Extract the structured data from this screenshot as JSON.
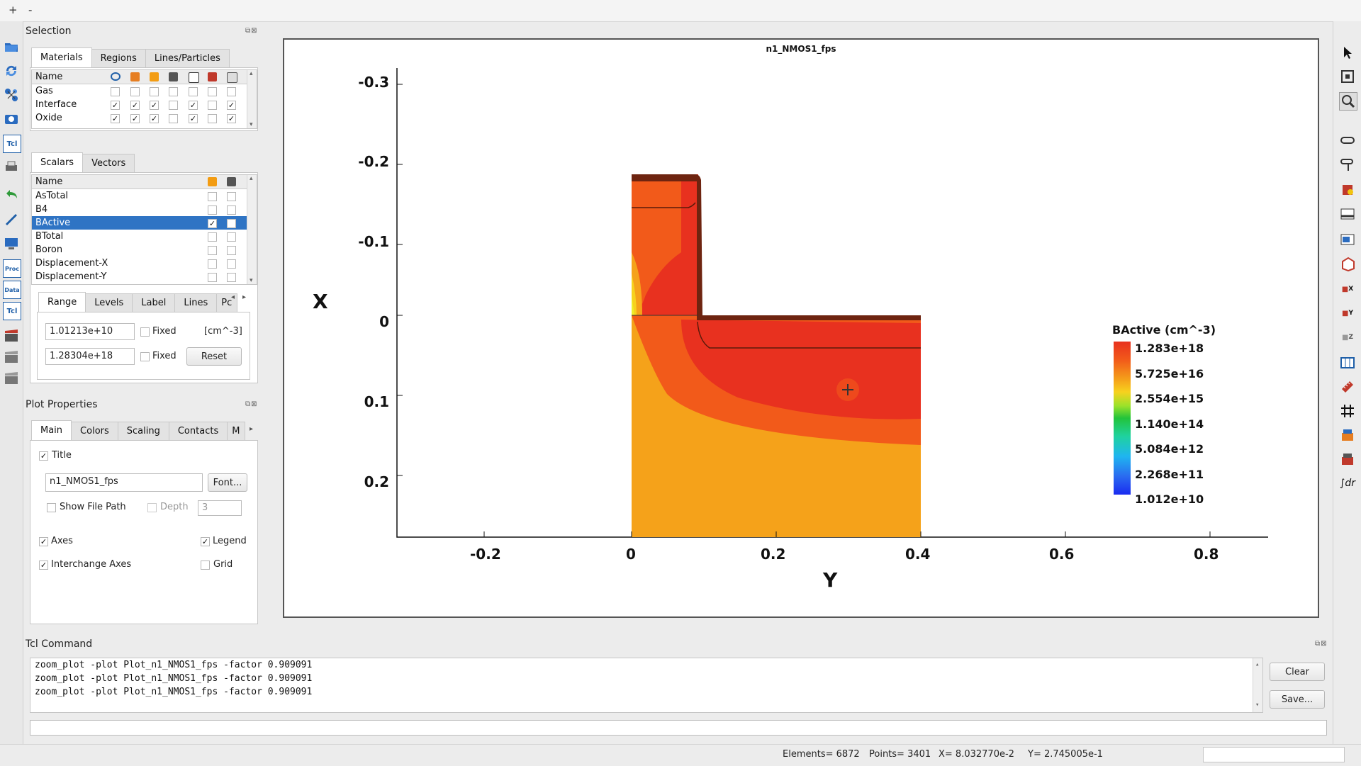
{
  "menubar": {
    "items": [
      "+",
      "-"
    ]
  },
  "left_toolbar": {
    "icons": [
      "open-folder-icon",
      "reload-icon",
      "molecule-icon",
      "camera-icon",
      "tcl-script-icon",
      "print-icon",
      "undo-icon",
      "pen-icon",
      "monitor-icon",
      "proc-icon",
      "data-icon",
      "tcl-icon",
      "clapper-icon",
      "clapper-2-icon",
      "clapper-3-icon"
    ],
    "labels": {
      "proc": "Proc",
      "data": "Data",
      "tcl": "Tcl",
      "tcl2": "Tcl"
    }
  },
  "right_toolbar": {
    "icons": [
      "pointer-icon",
      "fit-icon",
      "zoom-icon",
      "link-icon",
      "probe-icon",
      "probe-2-icon",
      "cutline-icon",
      "cutplane-icon",
      "cut-icon",
      "cut-x-icon",
      "cut-y-icon",
      "cut-z-icon",
      "data-table-icon",
      "ruler-icon",
      "grid-icon",
      "layers-icon",
      "layers-2-icon",
      "integrate-icon"
    ],
    "labels": {
      "x": "X",
      "y": "Y",
      "z": "Z",
      "integrate": "∫dr"
    }
  },
  "selection": {
    "title": "Selection",
    "tabs": [
      "Materials",
      "Regions",
      "Lines/Particles"
    ],
    "materials": {
      "header": "Name",
      "rows": [
        {
          "name": "Gas",
          "checks": [
            false,
            false,
            false,
            false,
            false,
            false,
            false
          ]
        },
        {
          "name": "Interface",
          "checks": [
            true,
            true,
            true,
            false,
            true,
            false,
            true
          ]
        },
        {
          "name": "Oxide",
          "checks": [
            true,
            true,
            true,
            false,
            true,
            false,
            true
          ]
        }
      ]
    },
    "scalar_tabs": [
      "Scalars",
      "Vectors"
    ],
    "scalars": {
      "header": "Name",
      "rows": [
        {
          "name": "AsTotal",
          "c1": false,
          "c2": false,
          "selected": false
        },
        {
          "name": "B4",
          "c1": false,
          "c2": false,
          "selected": false
        },
        {
          "name": "BActive",
          "c1": true,
          "c2": false,
          "selected": true
        },
        {
          "name": "BTotal",
          "c1": false,
          "c2": false,
          "selected": false
        },
        {
          "name": "Boron",
          "c1": false,
          "c2": false,
          "selected": false
        },
        {
          "name": "Displacement-X",
          "c1": false,
          "c2": false,
          "selected": false
        },
        {
          "name": "Displacement-Y",
          "c1": false,
          "c2": false,
          "selected": false
        }
      ]
    },
    "range_tabs": [
      "Range",
      "Levels",
      "Label",
      "Lines",
      "Pc"
    ],
    "range": {
      "min": "1.01213e+10",
      "max": "1.28304e+18",
      "fixed_label": "Fixed",
      "unit": "[cm^-3]",
      "reset": "Reset"
    }
  },
  "plot_properties": {
    "title": "Plot Properties",
    "tabs": [
      "Main",
      "Colors",
      "Scaling",
      "Contacts",
      "M"
    ],
    "title_check": {
      "label": "Title",
      "checked": true
    },
    "title_value": "n1_NMOS1_fps",
    "font_button": "Font...",
    "show_file_path": {
      "label": "Show File Path",
      "checked": false
    },
    "depth": {
      "label": "Depth",
      "value": "3"
    },
    "axes": {
      "label": "Axes",
      "checked": true
    },
    "legend": {
      "label": "Legend",
      "checked": true
    },
    "interchange_axes": {
      "label": "Interchange Axes",
      "checked": true
    },
    "grid": {
      "label": "Grid",
      "checked": false
    }
  },
  "plot": {
    "title": "n1_NMOS1_fps",
    "x_axis_label": "Y",
    "y_axis_label": "X",
    "x_ticks": [
      "-0.2",
      "0",
      "0.2",
      "0.4",
      "0.6",
      "0.8"
    ],
    "y_ticks": [
      "-0.3",
      "-0.2",
      "-0.1",
      "0",
      "0.1",
      "0.2"
    ],
    "legend_title": "BActive (cm^-3)",
    "legend_values": [
      "1.283e+18",
      "5.725e+16",
      "2.554e+15",
      "1.140e+14",
      "5.084e+12",
      "2.268e+11",
      "1.012e+10"
    ],
    "colors": {
      "c1": "#e8311f",
      "c2": "#f25a1a",
      "c3": "#f5a21a",
      "c4": "#f7d21e",
      "c5": "#eeee2a",
      "dark": "#6e2410"
    }
  },
  "tcl": {
    "title": "Tcl Command",
    "lines": [
      "zoom_plot -plot Plot_n1_NMOS1_fps -factor 0.909091",
      "zoom_plot -plot Plot_n1_NMOS1_fps -factor 0.909091",
      "zoom_plot -plot Plot_n1_NMOS1_fps -factor 0.909091"
    ],
    "clear": "Clear",
    "save": "Save...",
    "input": ""
  },
  "status": {
    "elements": "Elements= 6872",
    "points": "Points= 3401",
    "x": "X= 8.032770e-2",
    "y": "Y= 2.745005e-1"
  }
}
